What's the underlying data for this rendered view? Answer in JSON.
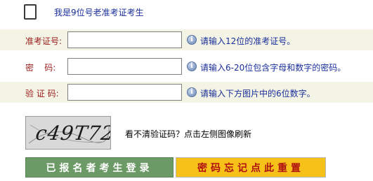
{
  "old_exam": {
    "checkbox_checked": false,
    "label": "我是9位号老准考证考生"
  },
  "fields": [
    {
      "label": "准考证号:",
      "value": "",
      "hint": "请输入12位的准考证号。",
      "icon": "info-icon"
    },
    {
      "label": "密    码:",
      "value": "",
      "hint": "请输入6-20位包含字母和数字的密码。",
      "icon": "info-icon"
    },
    {
      "label": "验 证 码:",
      "value": "",
      "hint": "请输入下方图片中的6位数字。",
      "icon": "info-icon"
    }
  ],
  "captcha": {
    "text": "c49T72",
    "hint": "看不清验证码？点击左侧图像刷新"
  },
  "buttons": {
    "login": "已报名者考生登录",
    "reset": "密码忘记点此重置"
  },
  "colors": {
    "label": "#9b1b1b",
    "hint": "#1a2e9a",
    "row_bg": "#f3f4e6",
    "login_bg": "#6c9a66",
    "reset_bg": "#f6c21a",
    "reset_text": "#b01010"
  }
}
